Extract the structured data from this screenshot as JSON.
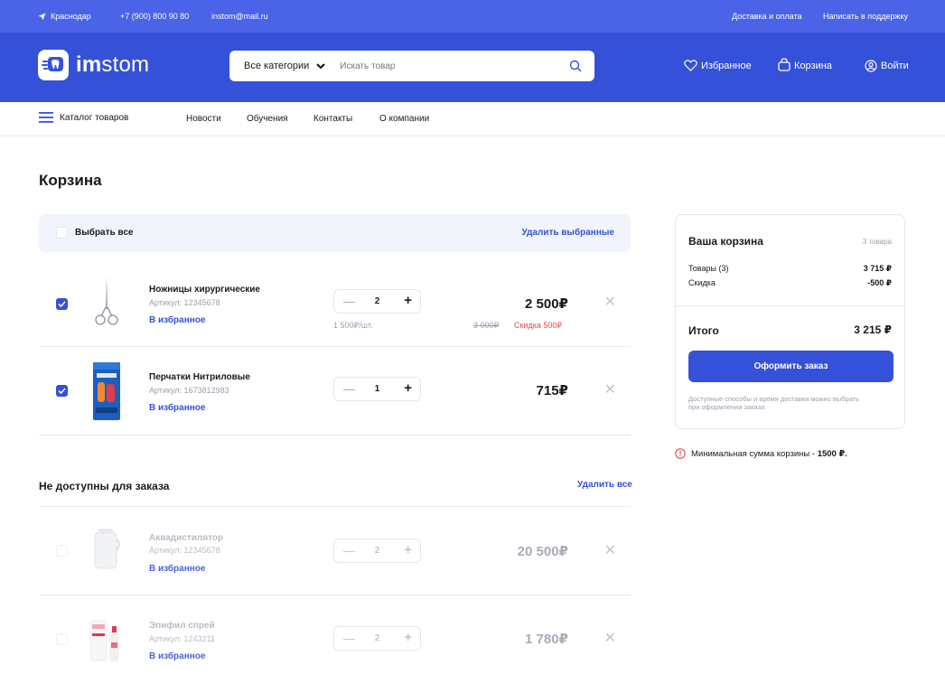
{
  "topbar": {
    "city": "Краснодар",
    "phone": "+7 (900) 800 90 80",
    "email": "instom@mail.ru",
    "delivery": "Доставка и оплата",
    "support": "Написать в поддержку"
  },
  "header": {
    "logo_bold": "im",
    "logo_rest": "stom",
    "category": "Все категории",
    "search_placeholder": "Искать товар",
    "favorites": "Избранное",
    "cart": "Корзина",
    "login": "Войти"
  },
  "menu": {
    "catalog": "Каталог товаров",
    "items": [
      "Новости",
      "Обучения",
      "Контакты",
      "О компании"
    ]
  },
  "page": {
    "title": "Корзина",
    "select_all": "Выбрать все",
    "delete_selected": "Удалить выбранные"
  },
  "cart_items": [
    {
      "name": "Ножницы хирургические",
      "article": "Артикул: 12345678",
      "fav": "В избранное",
      "qty": "2",
      "unit_price": "1 500₽/шт.",
      "price": "2 500₽",
      "old_price": "3 000₽",
      "discount": "Скидка 500₽",
      "checked": true
    },
    {
      "name": "Перчатки Нитриловые",
      "article": "Артикул: 1673812983",
      "fav": "В избранное",
      "qty": "1",
      "price": "715₽",
      "checked": true
    }
  ],
  "unavailable": {
    "title": "Не доступны для заказа",
    "delete_all": "Удалить все",
    "items": [
      {
        "name": "Аквадистилятор",
        "article": "Артикул: 12345678",
        "fav": "В избранное",
        "qty": "2",
        "price": "20 500₽"
      },
      {
        "name": "Эпифил спрей",
        "article": "Артикул: 1243211",
        "fav": "В избранное",
        "qty": "2",
        "price": "1 780₽"
      }
    ]
  },
  "summary": {
    "title": "Ваша корзина",
    "count": "3 товара",
    "goods_label": "Товары (3)",
    "goods_value": "3 715 ₽",
    "discount_label": "Скидка",
    "discount_value": "-500 ₽",
    "total_label": "Итого",
    "total_value": "3 215 ₽",
    "order_button": "Оформить заказ",
    "note": "Доступные способы и время доставки можно выбрать при оформлении заказа"
  },
  "min_sum": {
    "text": "Минимальная сумма корзины - ",
    "value": "1500 ₽."
  },
  "colors": {
    "primary": "#3551d9",
    "topbar": "#4a63e7",
    "discount": "#e54848"
  }
}
